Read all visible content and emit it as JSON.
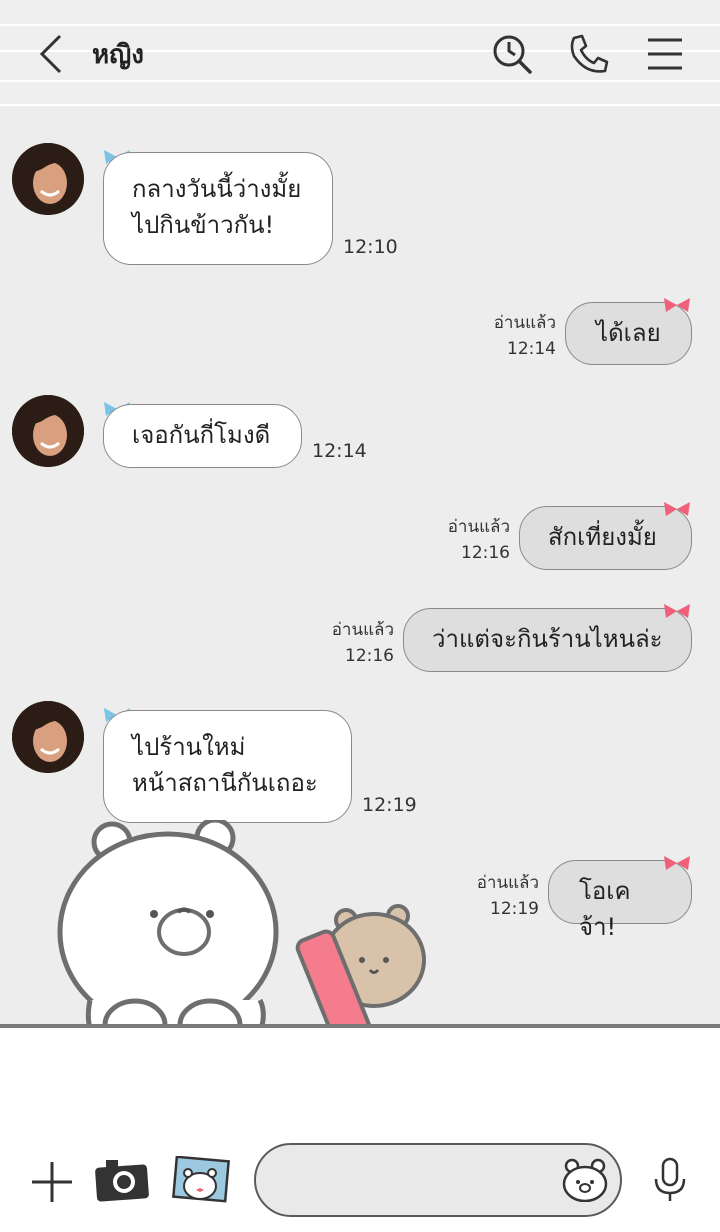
{
  "header": {
    "title": "หญิง"
  },
  "messages": [
    {
      "side": "them",
      "text": "กลางวันนี้ว่างมั้ย\nไปกินข้าวกัน!",
      "time": "12:10"
    },
    {
      "side": "me",
      "text": "ได้เลย",
      "read": "อ่านแล้ว",
      "time": "12:14"
    },
    {
      "side": "them",
      "text": "เจอกันกี่โมงดี",
      "time": "12:14"
    },
    {
      "side": "me",
      "text": "สักเที่ยงมั้ย",
      "read": "อ่านแล้ว",
      "time": "12:16"
    },
    {
      "side": "me",
      "text": "ว่าแต่จะกินร้านไหนล่ะ",
      "read": "อ่านแล้ว",
      "time": "12:16"
    },
    {
      "side": "them",
      "text": "ไปร้านใหม่\nหน้าสถานีกันเถอะ",
      "time": "12:19"
    },
    {
      "side": "me",
      "text": "โอเคจ้า!",
      "read": "อ่านแล้ว",
      "time": "12:19"
    }
  ],
  "colors": {
    "background": "#ededed",
    "bubble_me": "#dedede",
    "bubble_them": "#ffffff",
    "bow_them": "#7cc3e8",
    "bow_me": "#f0607a"
  },
  "icons": [
    "back-icon",
    "search-history-icon",
    "phone-icon",
    "menu-icon",
    "plus-icon",
    "camera-icon",
    "gallery-icon",
    "sticker-icon",
    "microphone-icon"
  ]
}
